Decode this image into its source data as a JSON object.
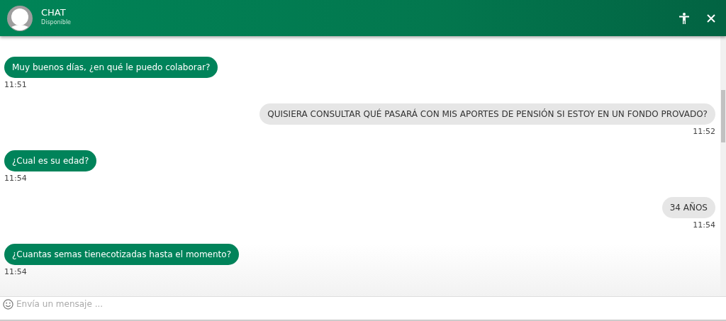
{
  "header": {
    "title": "CHAT",
    "status": "Disponible"
  },
  "messages": [
    {
      "kind": "agent",
      "text": "Muy buenos días, ¿en qué le puedo colaborar?",
      "time": "11:51"
    },
    {
      "kind": "user",
      "text": "QUISIERA CONSULTAR QUÉ PASARÁ CON MIS APORTES DE PENSIÓN SI ESTOY EN UN FONDO PROVADO?",
      "time": "11:52"
    },
    {
      "kind": "agent",
      "text": "¿Cual es su edad?",
      "time": "11:54"
    },
    {
      "kind": "user",
      "text": "34 AÑOS",
      "time": "11:54"
    },
    {
      "kind": "agent",
      "text": "¿Cuantas semas tienecotizadas hasta el momento?",
      "time": "11:54"
    }
  ],
  "composer": {
    "placeholder": "Envía un mensaje ..."
  }
}
